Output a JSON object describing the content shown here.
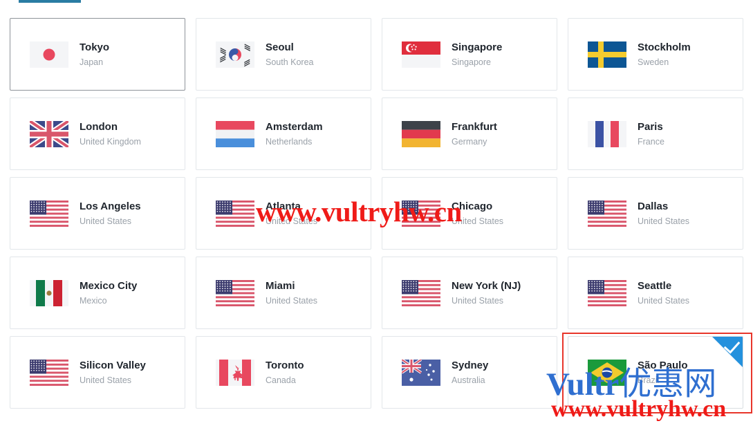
{
  "tab": {
    "name": "locations-tab",
    "accent_color": "#2a7ca3"
  },
  "annotation": {
    "color": "#e8352a",
    "target": "São Paulo"
  },
  "selection": {
    "selected_city": "São Paulo",
    "current_city": "Tokyo",
    "check_color": "#2491dd"
  },
  "watermarks": {
    "url_middle": "www.vultryhw.cn",
    "url_bottom": "www.vultryhw.cn",
    "brand_latin": "Vultr",
    "brand_cjk": "优惠网",
    "url_color": "#ef1b18",
    "brand_color": "#2f6fd0"
  },
  "locations": [
    {
      "city": "Tokyo",
      "country": "Japan",
      "flag": "jp-flag-icon",
      "state": "current"
    },
    {
      "city": "Seoul",
      "country": "South Korea",
      "flag": "kr-flag-icon",
      "state": "normal"
    },
    {
      "city": "Singapore",
      "country": "Singapore",
      "flag": "sg-flag-icon",
      "state": "normal"
    },
    {
      "city": "Stockholm",
      "country": "Sweden",
      "flag": "se-flag-icon",
      "state": "normal"
    },
    {
      "city": "London",
      "country": "United Kingdom",
      "flag": "gb-flag-icon",
      "state": "normal"
    },
    {
      "city": "Amsterdam",
      "country": "Netherlands",
      "flag": "nl-flag-icon",
      "state": "normal"
    },
    {
      "city": "Frankfurt",
      "country": "Germany",
      "flag": "de-flag-icon",
      "state": "normal"
    },
    {
      "city": "Paris",
      "country": "France",
      "flag": "fr-flag-icon",
      "state": "normal"
    },
    {
      "city": "Los Angeles",
      "country": "United States",
      "flag": "us-flag-icon",
      "state": "normal"
    },
    {
      "city": "Atlanta",
      "country": "United States",
      "flag": "us-flag-icon",
      "state": "normal"
    },
    {
      "city": "Chicago",
      "country": "United States",
      "flag": "us-flag-icon",
      "state": "normal"
    },
    {
      "city": "Dallas",
      "country": "United States",
      "flag": "us-flag-icon",
      "state": "normal"
    },
    {
      "city": "Mexico City",
      "country": "Mexico",
      "flag": "mx-flag-icon",
      "state": "normal"
    },
    {
      "city": "Miami",
      "country": "United States",
      "flag": "us-flag-icon",
      "state": "normal"
    },
    {
      "city": "New York (NJ)",
      "country": "United States",
      "flag": "us-flag-icon",
      "state": "normal"
    },
    {
      "city": "Seattle",
      "country": "United States",
      "flag": "us-flag-icon",
      "state": "normal"
    },
    {
      "city": "Silicon Valley",
      "country": "United States",
      "flag": "us-flag-icon",
      "state": "normal"
    },
    {
      "city": "Toronto",
      "country": "Canada",
      "flag": "ca-flag-icon",
      "state": "normal"
    },
    {
      "city": "Sydney",
      "country": "Australia",
      "flag": "au-flag-icon",
      "state": "normal"
    },
    {
      "city": "São Paulo",
      "country": "Brazil",
      "flag": "br-flag-icon",
      "state": "selected"
    }
  ]
}
